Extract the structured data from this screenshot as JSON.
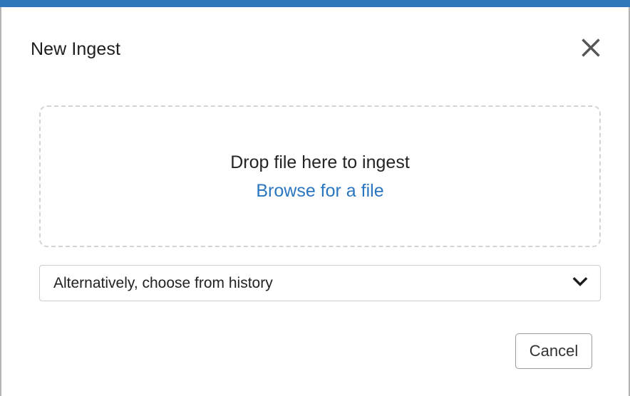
{
  "theme": {
    "accent_color": "#2f76b8",
    "link_color": "#2a76c0",
    "border_color": "#cccccc",
    "dashed_border_color": "#d4d4d4",
    "text_color": "#1e1e1e"
  },
  "dialog": {
    "title": "New Ingest",
    "close_icon": "close-x-icon",
    "close_label": "Close"
  },
  "dropzone": {
    "prompt": "Drop file here to ingest",
    "browse_link": "Browse for a file"
  },
  "history": {
    "selected_option": "Alternatively, choose from history",
    "chevron_icon": "chevron-down-icon",
    "options": [
      "Alternatively, choose from history"
    ]
  },
  "footer": {
    "cancel_label": "Cancel"
  }
}
